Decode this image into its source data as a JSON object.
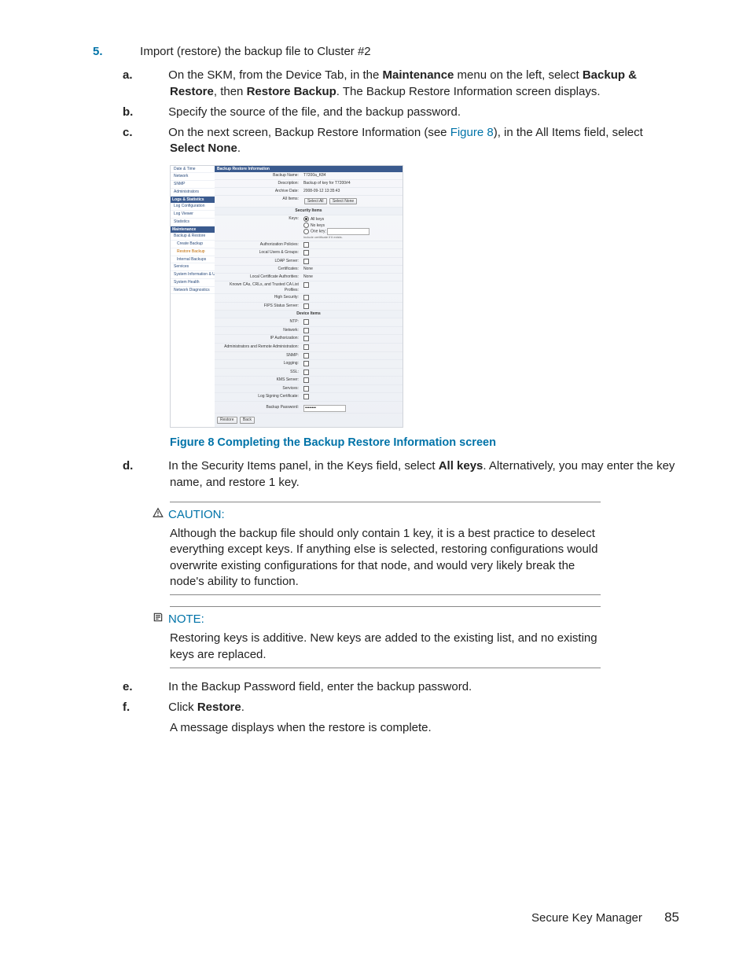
{
  "step": {
    "number": "5.",
    "text_before": "Import (restore) the backup file to Cluster #2"
  },
  "sub": {
    "a": {
      "letter": "a.",
      "t1": "On the SKM, from the Device Tab, in the ",
      "b1": "Maintenance",
      "t2": " menu on the left, select ",
      "b2": "Backup & Restore",
      "t3": ", then ",
      "b3": "Restore Backup",
      "t4": ". The Backup Restore Information screen displays."
    },
    "b": {
      "letter": "b.",
      "text": "Specify the source of the file, and the backup password."
    },
    "c": {
      "letter": "c.",
      "t1": "On the next screen, Backup Restore Information (see ",
      "link": "Figure 8",
      "t2": "), in the All Items field, select ",
      "b1": "Select None",
      "t3": "."
    },
    "d": {
      "letter": "d.",
      "t1": "In the Security Items panel, in the Keys field, select ",
      "b1": "All keys",
      "t2": ". Alternatively, you may enter the key name, and restore 1 key."
    },
    "e": {
      "letter": "e.",
      "text": "In the Backup Password field, enter the backup password."
    },
    "f": {
      "letter": "f.",
      "t1": "Click ",
      "b1": "Restore",
      "t2": ".",
      "after": "A message displays when the restore is complete."
    }
  },
  "figcaption": "Figure 8 Completing the Backup Restore Information screen",
  "caution": {
    "head": "CAUTION:",
    "body": "Although the backup file should only contain 1 key, it is a best practice to deselect everything except keys. If anything else is selected, restoring configurations would overwrite existing configurations for that node, and would very likely break the node's ability to function."
  },
  "note": {
    "head": "NOTE:",
    "body": "Restoring keys is additive. New keys are added to the existing list, and no existing keys are replaced."
  },
  "footer": {
    "title": "Secure Key Manager",
    "page": "85"
  },
  "shot": {
    "title": "Backup Restore Information",
    "side": {
      "top": [
        "Date & Time",
        "Network",
        "SNMP",
        "Administrators"
      ],
      "grp2": "Logs & Statistics",
      "g2": [
        "Log Configuration",
        "Log Viewer",
        "Statistics"
      ],
      "grp3": "Maintenance",
      "g3": [
        "Backup & Restore",
        "  Create Backup",
        "  Restore Backup",
        "  Internal Backups",
        "Services",
        "System Information & Upgrade",
        "System Health",
        "Network Diagnostics"
      ]
    },
    "rows1": {
      "backup_name_l": "Backup Name:",
      "backup_name_v": "T7200a_K84",
      "desc_l": "Description:",
      "desc_v": "Backup of key for T7200#4",
      "arch_l": "Archive Date:",
      "arch_v": "2008-09-12 13:35:43",
      "all_l": "All Items:",
      "btn_sel": "Select All",
      "btn_none": "Select None"
    },
    "sec_security": "Security Items",
    "keys_l": "Keys:",
    "keys_opts": {
      "all": "All keys",
      "none": "No keys",
      "one": "One key:"
    },
    "keys_hint": "Include certificate if it exists.",
    "sec_rows": [
      "Authorization Policies:",
      "Local Users & Groups:",
      "LDAP Server:",
      "Certificates:",
      "Local Certificate Authorities:",
      "Known CAs, CRLs, and Trusted CA List Profiles:",
      "High Security:",
      "FIPS Status Server:"
    ],
    "cert_none": "None",
    "lca_none": "None",
    "sec_device": "Device Items",
    "dev_rows": [
      "NTP:",
      "Network:",
      "IP Authorization:",
      "Administrators and Remote Administration:",
      "SNMP:",
      "Logging:",
      "SSL:",
      "KMS Server:",
      "Services:",
      "Log Signing Certificate:"
    ],
    "pwd_l": "Backup Password:",
    "pwd_v": "••••••••",
    "btn_restore": "Restore",
    "btn_back": "Back"
  }
}
